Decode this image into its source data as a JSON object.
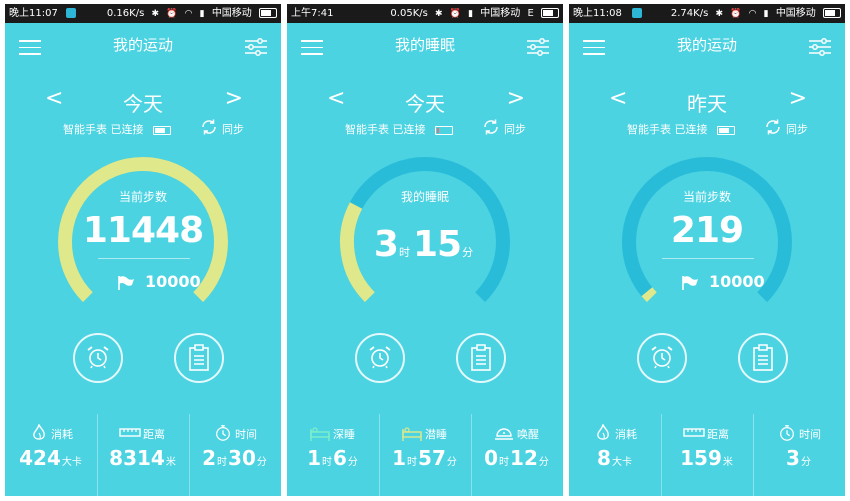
{
  "screens": [
    {
      "status": {
        "time": "晚上11:07",
        "speed": "0.16K/s",
        "carrier": "中国移动"
      },
      "title": "我的运动",
      "day": "今天",
      "watch_status": "智能手表 已连接",
      "watch_battery": 0.7,
      "sync": "同步",
      "metric_label": "当前步数",
      "value": "11448",
      "goal": "10000",
      "progress": 1.0,
      "stats": [
        {
          "icon": "flame-icon",
          "label": "消耗",
          "parts": [
            "424",
            "大卡"
          ]
        },
        {
          "icon": "ruler-icon",
          "label": "距离",
          "parts": [
            "8314",
            "米"
          ]
        },
        {
          "icon": "stopwatch-icon",
          "label": "时间",
          "parts": [
            "2",
            "时",
            "30",
            "分"
          ]
        }
      ]
    },
    {
      "status": {
        "time": "上午7:41",
        "speed": "0.05K/s",
        "carrier": "中国移动",
        "net": "E"
      },
      "title": "我的睡眠",
      "day": "今天",
      "watch_status": "智能手表 已连接",
      "watch_battery": 0.15,
      "sync": "同步",
      "metric_label": "我的睡眠",
      "value_parts": [
        "3",
        "时",
        "15",
        "分"
      ],
      "progress": 0.27,
      "stats": [
        {
          "icon": "deep-sleep-icon",
          "label": "深睡",
          "parts": [
            "1",
            "时",
            "6",
            "分"
          ]
        },
        {
          "icon": "light-sleep-icon",
          "label": "潜睡",
          "parts": [
            "1",
            "时",
            "57",
            "分"
          ]
        },
        {
          "icon": "awake-icon",
          "label": "唤醒",
          "parts": [
            "0",
            "时",
            "12",
            "分"
          ]
        }
      ]
    },
    {
      "status": {
        "time": "晚上11:08",
        "speed": "2.74K/s",
        "carrier": "中国移动"
      },
      "title": "我的运动",
      "day": "昨天",
      "watch_status": "智能手表 已连接",
      "watch_battery": 0.7,
      "sync": "同步",
      "metric_label": "当前步数",
      "value": "219",
      "goal": "10000",
      "progress": 0.02,
      "stats": [
        {
          "icon": "flame-icon",
          "label": "消耗",
          "parts": [
            "8",
            "大卡"
          ]
        },
        {
          "icon": "ruler-icon",
          "label": "距离",
          "parts": [
            "159",
            "米"
          ]
        },
        {
          "icon": "stopwatch-icon",
          "label": "时间",
          "parts": [
            "3",
            "分"
          ]
        }
      ]
    }
  ],
  "colors": {
    "background": "#4bd3e2",
    "track": "#29bcd9",
    "progress": "#dfe88a",
    "statusbar": "#1a1a1a"
  }
}
